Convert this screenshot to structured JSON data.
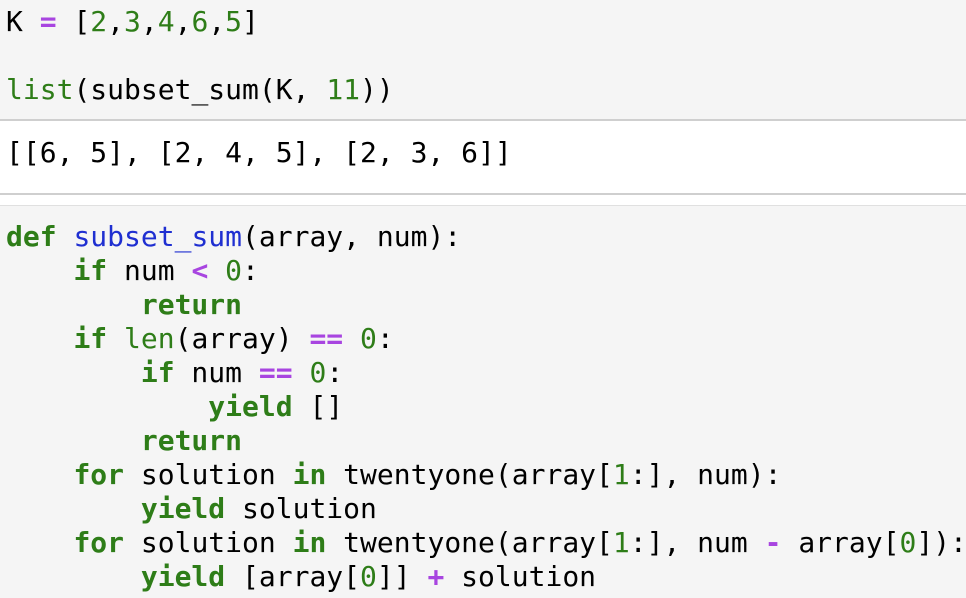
{
  "cells": {
    "top_input": {
      "lines": [
        [
          {
            "t": "K ",
            "c": "plain"
          },
          {
            "t": "=",
            "c": "op"
          },
          {
            "t": " [",
            "c": "plain"
          },
          {
            "t": "2",
            "c": "num"
          },
          {
            "t": ",",
            "c": "plain"
          },
          {
            "t": "3",
            "c": "num"
          },
          {
            "t": ",",
            "c": "plain"
          },
          {
            "t": "4",
            "c": "num"
          },
          {
            "t": ",",
            "c": "plain"
          },
          {
            "t": "6",
            "c": "num"
          },
          {
            "t": ",",
            "c": "plain"
          },
          {
            "t": "5",
            "c": "num"
          },
          {
            "t": "]",
            "c": "plain"
          }
        ],
        [],
        [
          {
            "t": "list",
            "c": "builtin"
          },
          {
            "t": "(subset_sum(K, ",
            "c": "plain"
          },
          {
            "t": "11",
            "c": "num"
          },
          {
            "t": "))",
            "c": "plain"
          }
        ]
      ]
    },
    "output": {
      "text": "[[6, 5], [2, 4, 5], [2, 3, 6]]"
    },
    "bottom_input": {
      "lines": [
        [
          {
            "t": "def",
            "c": "kw"
          },
          {
            "t": " ",
            "c": "plain"
          },
          {
            "t": "subset_sum",
            "c": "fn-def"
          },
          {
            "t": "(array, num):",
            "c": "plain"
          }
        ],
        [
          {
            "t": "    ",
            "c": "plain"
          },
          {
            "t": "if",
            "c": "kw"
          },
          {
            "t": " num ",
            "c": "plain"
          },
          {
            "t": "<",
            "c": "op"
          },
          {
            "t": " ",
            "c": "plain"
          },
          {
            "t": "0",
            "c": "num"
          },
          {
            "t": ":",
            "c": "plain"
          }
        ],
        [
          {
            "t": "        ",
            "c": "plain"
          },
          {
            "t": "return",
            "c": "kw"
          }
        ],
        [
          {
            "t": "    ",
            "c": "plain"
          },
          {
            "t": "if",
            "c": "kw"
          },
          {
            "t": " ",
            "c": "plain"
          },
          {
            "t": "len",
            "c": "builtin"
          },
          {
            "t": "(array) ",
            "c": "plain"
          },
          {
            "t": "==",
            "c": "op"
          },
          {
            "t": " ",
            "c": "plain"
          },
          {
            "t": "0",
            "c": "num"
          },
          {
            "t": ":",
            "c": "plain"
          }
        ],
        [
          {
            "t": "        ",
            "c": "plain"
          },
          {
            "t": "if",
            "c": "kw"
          },
          {
            "t": " num ",
            "c": "plain"
          },
          {
            "t": "==",
            "c": "op"
          },
          {
            "t": " ",
            "c": "plain"
          },
          {
            "t": "0",
            "c": "num"
          },
          {
            "t": ":",
            "c": "plain"
          }
        ],
        [
          {
            "t": "            ",
            "c": "plain"
          },
          {
            "t": "yield",
            "c": "kw"
          },
          {
            "t": " []",
            "c": "plain"
          }
        ],
        [
          {
            "t": "        ",
            "c": "plain"
          },
          {
            "t": "return",
            "c": "kw"
          }
        ],
        [
          {
            "t": "    ",
            "c": "plain"
          },
          {
            "t": "for",
            "c": "kw"
          },
          {
            "t": " solution ",
            "c": "plain"
          },
          {
            "t": "in",
            "c": "kw"
          },
          {
            "t": " twentyone(array[",
            "c": "plain"
          },
          {
            "t": "1",
            "c": "num"
          },
          {
            "t": ":], num):",
            "c": "plain"
          }
        ],
        [
          {
            "t": "        ",
            "c": "plain"
          },
          {
            "t": "yield",
            "c": "kw"
          },
          {
            "t": " solution",
            "c": "plain"
          }
        ],
        [
          {
            "t": "    ",
            "c": "plain"
          },
          {
            "t": "for",
            "c": "kw"
          },
          {
            "t": " solution ",
            "c": "plain"
          },
          {
            "t": "in",
            "c": "kw"
          },
          {
            "t": " twentyone(array[",
            "c": "plain"
          },
          {
            "t": "1",
            "c": "num"
          },
          {
            "t": ":], num ",
            "c": "plain"
          },
          {
            "t": "-",
            "c": "op"
          },
          {
            "t": " array[",
            "c": "plain"
          },
          {
            "t": "0",
            "c": "num"
          },
          {
            "t": "]):",
            "c": "plain"
          }
        ],
        [
          {
            "t": "        ",
            "c": "plain"
          },
          {
            "t": "yield",
            "c": "kw"
          },
          {
            "t": " [array[",
            "c": "plain"
          },
          {
            "t": "0",
            "c": "num"
          },
          {
            "t": "]] ",
            "c": "plain"
          },
          {
            "t": "+",
            "c": "op"
          },
          {
            "t": " solution",
            "c": "plain"
          }
        ]
      ]
    }
  }
}
